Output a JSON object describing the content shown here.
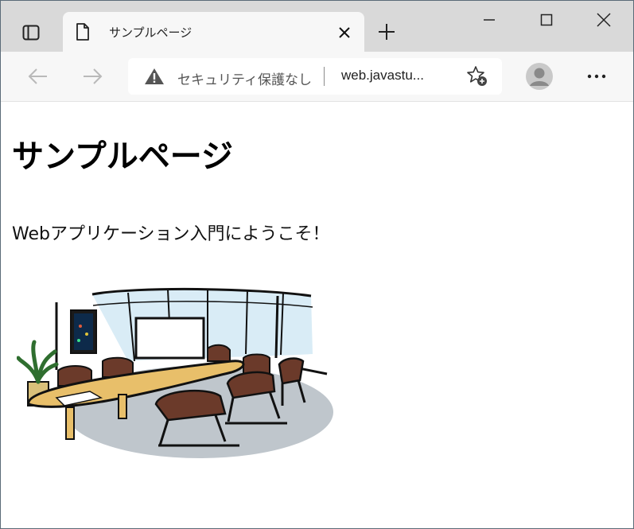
{
  "browser": {
    "tab": {
      "title": "サンプルページ"
    },
    "address_bar": {
      "security_text": "セキュリティ保護なし",
      "url": "web.javastu..."
    },
    "menu_label": "···"
  },
  "page": {
    "heading": "サンプルページ",
    "text": "Webアプリケーション入門にようこそ！",
    "image": {
      "subject": "conference-room-illustration"
    }
  },
  "colors": {
    "tabstrip": "#d9d9d9",
    "toolbar": "#f7f7f7",
    "table": "#e8bf6a",
    "chair": "#6b3a2a",
    "floor": "#bfc6cc",
    "window_glass": "#cfe5f2"
  }
}
